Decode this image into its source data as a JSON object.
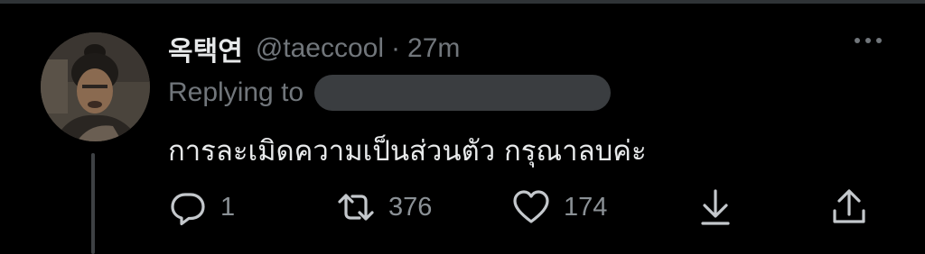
{
  "tweet": {
    "display_name": "옥택연",
    "handle": "@taeccool",
    "separator": "·",
    "time": "27m",
    "replying_to_label": "Replying to",
    "text": "การละเมิดความเป็นส่วนตัว กรุณาลบค่ะ"
  },
  "actions": {
    "replies": "1",
    "retweets": "376",
    "likes": "174"
  },
  "icons": {
    "reply": "speech-bubble",
    "retweet": "retweet-arrows",
    "like": "heart-outline",
    "download": "arrow-down-to-line",
    "share": "share-up-arrow",
    "more": "three-dots"
  },
  "colors": {
    "background": "#000000",
    "primary_text": "#e7e9ea",
    "secondary_text": "#71767b",
    "redaction": "#3a3d40"
  }
}
